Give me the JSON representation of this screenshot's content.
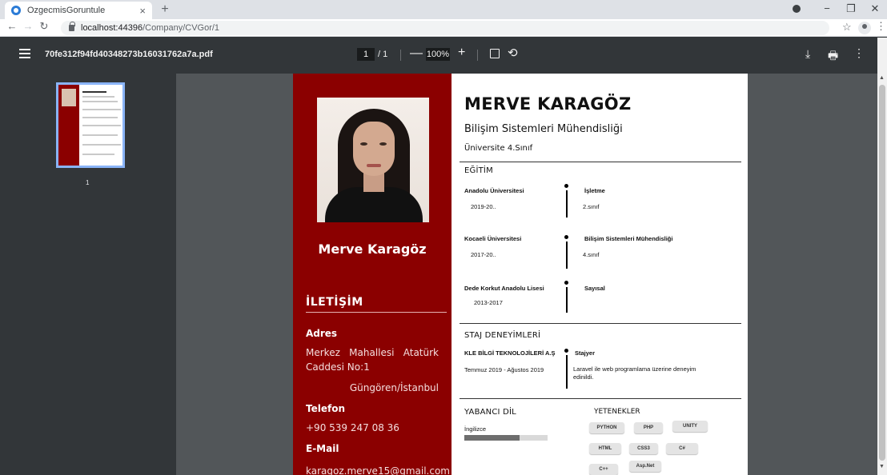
{
  "browser": {
    "tab_title": "OzgecmisGoruntule",
    "tab_close": "×",
    "new_tab": "+",
    "url_host": "localhost:44396",
    "url_path": "/Company/CVGor/1",
    "win_min": "−",
    "win_max": "❐",
    "win_close": "✕",
    "star": "☆",
    "menu": "⋮"
  },
  "pdf_viewer": {
    "filename": "70fe312f94fd40348273b16031762a7a.pdf",
    "page_current": "1",
    "page_total": "/ 1",
    "zoom": "100%",
    "zoom_out": "—",
    "zoom_in": "+",
    "rotate": "⟲",
    "download": "⤓",
    "print": "🖶",
    "more": "⋮",
    "thumb_label": "1"
  },
  "cv": {
    "left": {
      "name": "Merve Karagöz",
      "contact_heading": "İLETİŞİM",
      "address_label": "Adres",
      "address_line1": "Merkez Mahallesi Atatürk",
      "address_line2": "Caddesi No:1",
      "address_line3": "Güngören/İstanbul",
      "phone_label": "Telefon",
      "phone": "+90 539 247 08 36",
      "email_label": "E-Mail",
      "email": "karagoz.merve15@gmail.com"
    },
    "right": {
      "name": "MERVE KARAGÖZ",
      "title": "Bilişim Sistemleri Mühendisliği",
      "year": "Üniversite 4.Sınıf",
      "education_heading": "EĞİTİM",
      "education": [
        {
          "school": "Anadolu Üniversitesi",
          "years": "2019-20..",
          "department": "İşletme",
          "class": "2.sınıf"
        },
        {
          "school": "Kocaeli Üniversitesi",
          "years": "2017-20..",
          "department": "Bilişim Sistemleri Mühendisliği",
          "class": "4.sınıf"
        },
        {
          "school": "Dede Korkut Anadolu Lisesi",
          "years": "2013-2017",
          "department": "Sayısal",
          "class": ""
        }
      ],
      "internship_heading": "STAJ DENEYİMLERİ",
      "internship": {
        "company": "KLE BİLGİ TEKNOLOJİLERİ A.Ş",
        "dates": "Temmuz 2019 - Ağustos 2019",
        "role": "Stajyer",
        "description": "Laravel ile web programlama üzerine deneyim edinildi."
      },
      "languages_heading": "YABANCI DİL",
      "language": "İngilizce",
      "language_level": 0.66,
      "skills_heading": "YETENEKLER",
      "skills": [
        "PYTHON",
        "PHP",
        "UNITY",
        "HTML",
        "CSS3",
        "C#",
        "C++",
        "Asp.Net"
      ]
    }
  },
  "colors": {
    "cv_accent": "#8b0000",
    "viewer_bg": "#525659",
    "toolbar_bg": "#323639"
  }
}
